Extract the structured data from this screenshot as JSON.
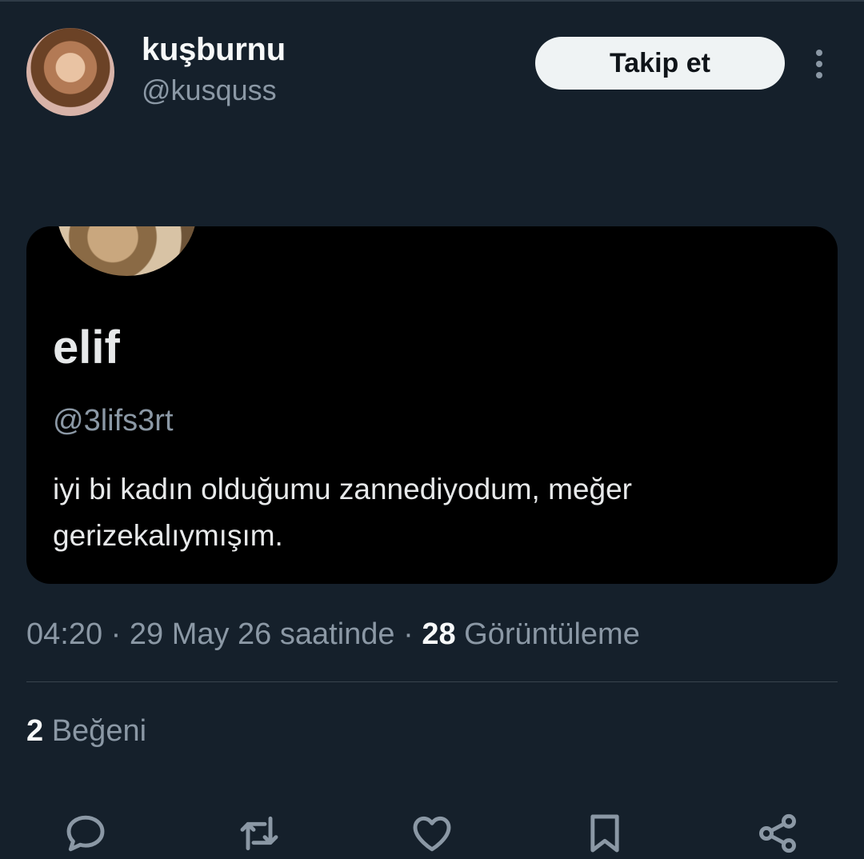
{
  "author": {
    "name": "kuşburnu",
    "handle": "@kusquss",
    "follow_label": "Takip et"
  },
  "quoted": {
    "name": "elif",
    "handle": "@3lifs3rt",
    "text": "iyi bi kadın olduğumu zannediyodum, meğer gerizekalıymışım."
  },
  "meta": {
    "time": "04:20",
    "sep1": "·",
    "date": "29 May 26 saatinde",
    "sep2": "·",
    "views_count": "28",
    "views_label": "Görüntüleme"
  },
  "likes": {
    "count": "2",
    "label": "Beğeni"
  },
  "actions": [
    "reply-icon",
    "retweet-icon",
    "like-icon",
    "bookmark-icon",
    "share-icon"
  ],
  "colors": {
    "background": "#15202b",
    "secondary_text": "#8b98a5",
    "primary_text": "#f7f9f9",
    "card_background": "#000000",
    "follow_button": "#eff3f4"
  }
}
